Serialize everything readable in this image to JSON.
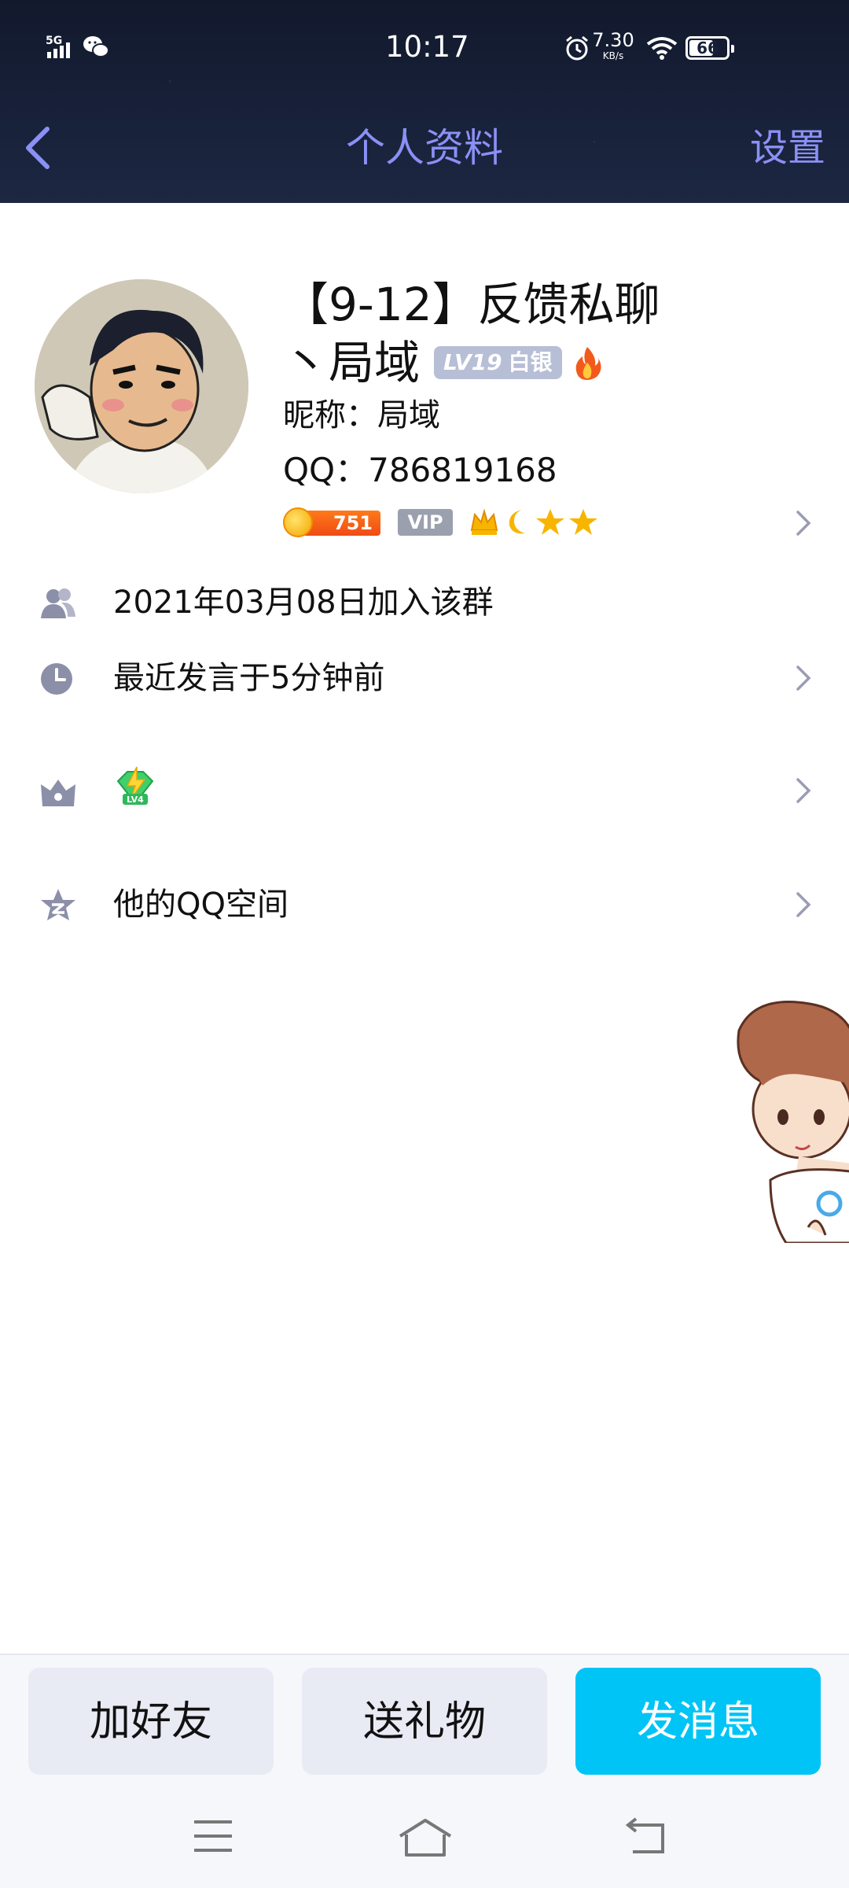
{
  "status_bar": {
    "network": "5G",
    "time": "10:17",
    "speed_value": "7.30",
    "speed_unit": "KB/s",
    "battery": "66"
  },
  "nav": {
    "title": "个人资料",
    "settings": "设置"
  },
  "profile": {
    "name_line1": "【9-12】反馈私聊",
    "name_line2": "丶局域",
    "level_prefix": "LV19",
    "level_rank": "白银",
    "nickname": "昵称：局域",
    "qq": "QQ：786819168",
    "coin_count": "751",
    "vip_label": "VIP"
  },
  "rows": {
    "joined": "2021年03月08日加入该群",
    "last_spoke": "最近发言于5分钟前",
    "qzone": "他的QQ空间"
  },
  "actions": {
    "add_friend": "加好友",
    "send_gift": "送礼物",
    "send_message": "发消息"
  },
  "colors": {
    "header_bg": "#16213a",
    "accent_purple": "#8b90f5",
    "primary_button": "#00c4f5",
    "icon_grey": "#8c8fa8"
  }
}
